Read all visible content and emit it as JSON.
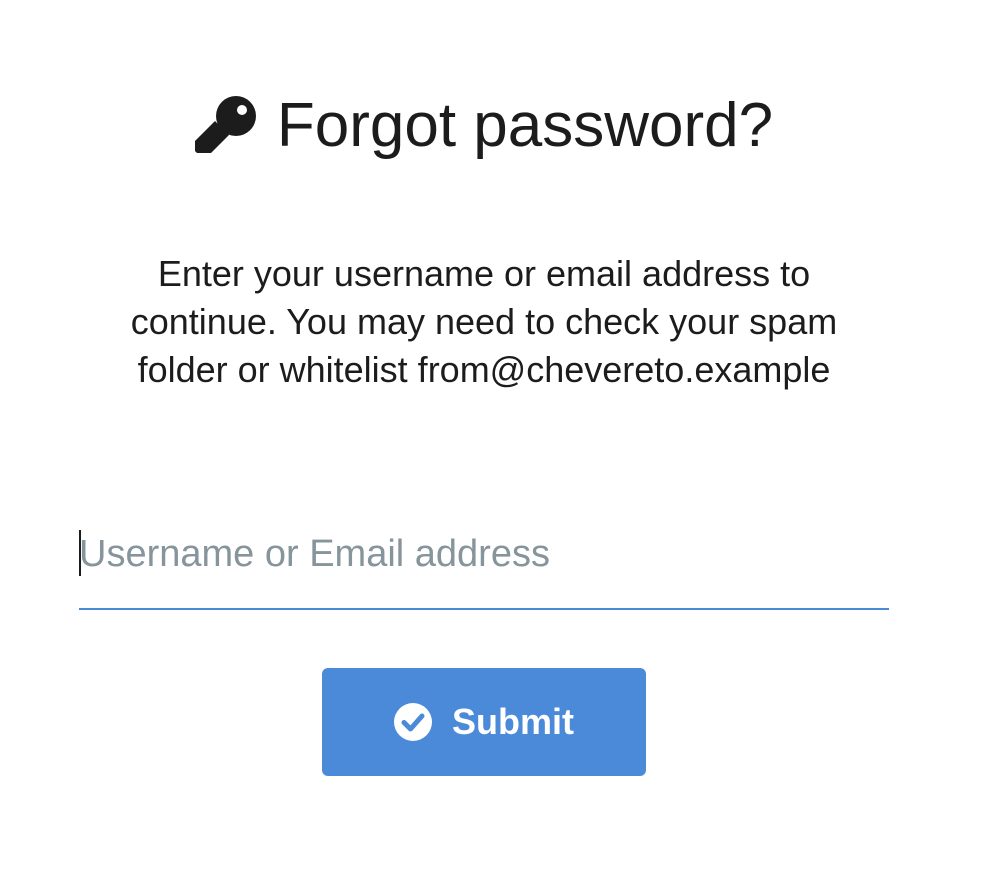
{
  "header": {
    "icon": "key-icon",
    "title": "Forgot password?"
  },
  "description": "Enter your username or email address to continue. You may need to check your spam folder or whitelist from@chevereto.example",
  "form": {
    "input": {
      "value": "",
      "placeholder": "Username or Email address"
    },
    "submit": {
      "icon": "check-circle-icon",
      "label": "Submit"
    }
  },
  "colors": {
    "accent": "#4a8ad9",
    "text": "#1c1c1c",
    "placeholder": "#86949c"
  }
}
